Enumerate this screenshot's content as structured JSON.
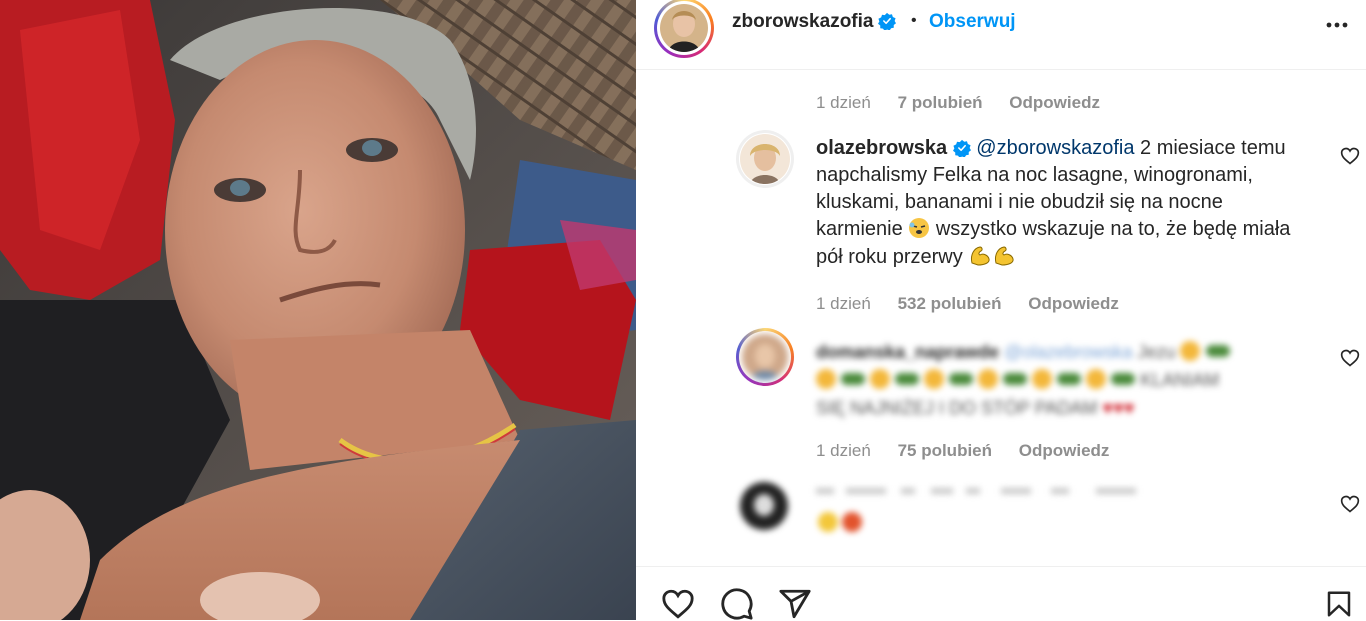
{
  "post": {
    "author": "zborowskazofia",
    "separator": "•",
    "follow_label": "Obserwuj"
  },
  "owner_comment_meta": {
    "time": "1 dzień",
    "likes": "7 polubień",
    "reply": "Odpowiedz"
  },
  "comments": [
    {
      "username": "olazebrowska",
      "mention": "@zborowskazofia",
      "lines": [
        " 2 miesiace temu",
        "napchalismy Felka na noc lasagne, winogronami,",
        "kluskami, bananami i nie obudził się na nocne",
        "karmienie ",
        " wszystko wskazuje na to, że będę miała",
        "pół roku przerwy "
      ],
      "time": "1 dzień",
      "likes": "532 polubień",
      "reply": "Odpowiedz"
    },
    {
      "username": "domanska_naprawde",
      "mention": "@olazebrowska",
      "lines": [
        " Jezu",
        "KLANIAM",
        "SIĘ NAJNIŻEJ I DO STÓP PADAM"
      ],
      "time": "1 dzień",
      "likes": "75 polubień",
      "reply": "Odpowiedz"
    }
  ],
  "colors": {
    "accent": "#0095f6",
    "verified": "#0095f6",
    "meta_text": "#8e8e8e",
    "text": "#262626"
  },
  "icons": {
    "more": "more-horizontal-icon",
    "like": "heart-icon",
    "comment": "comment-icon",
    "share": "paper-plane-icon",
    "save": "bookmark-icon"
  }
}
